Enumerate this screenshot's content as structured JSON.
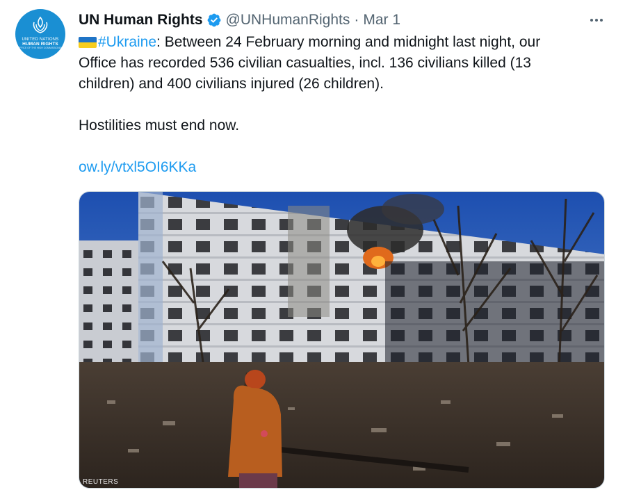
{
  "account": {
    "display_name": "UN Human Rights",
    "handle": "@UNHumanRights",
    "separator": "·",
    "date": "Mar 1",
    "avatar": {
      "org_line": "UNITED NATIONS",
      "name_line": "HUMAN RIGHTS",
      "sub_line": "OFFICE OF THE HIGH COMMISSIONER"
    }
  },
  "tweet": {
    "hashtag": "#Ukraine",
    "line1_rest": ": Between 24 February morning and midnight last night, our",
    "line2": "Office has recorded 536 civilian casualties, incl. 136 civilians killed (13",
    "line3": "children) and 400 civilians injured (26 children).",
    "line4": "Hostilities must end now.",
    "link": "ow.ly/vtxl5OI6KKa"
  },
  "media": {
    "credit": "REUTERS"
  },
  "icons": {
    "verified": "verified-badge-icon",
    "more": "more-options-icon",
    "flag": "ukraine-flag-icon",
    "emblem": "un-human-rights-emblem-icon"
  },
  "colors": {
    "link": "#1d9bf0",
    "text": "#0f1419",
    "secondary": "#536471",
    "avatar_bg": "#1a8fd3"
  }
}
